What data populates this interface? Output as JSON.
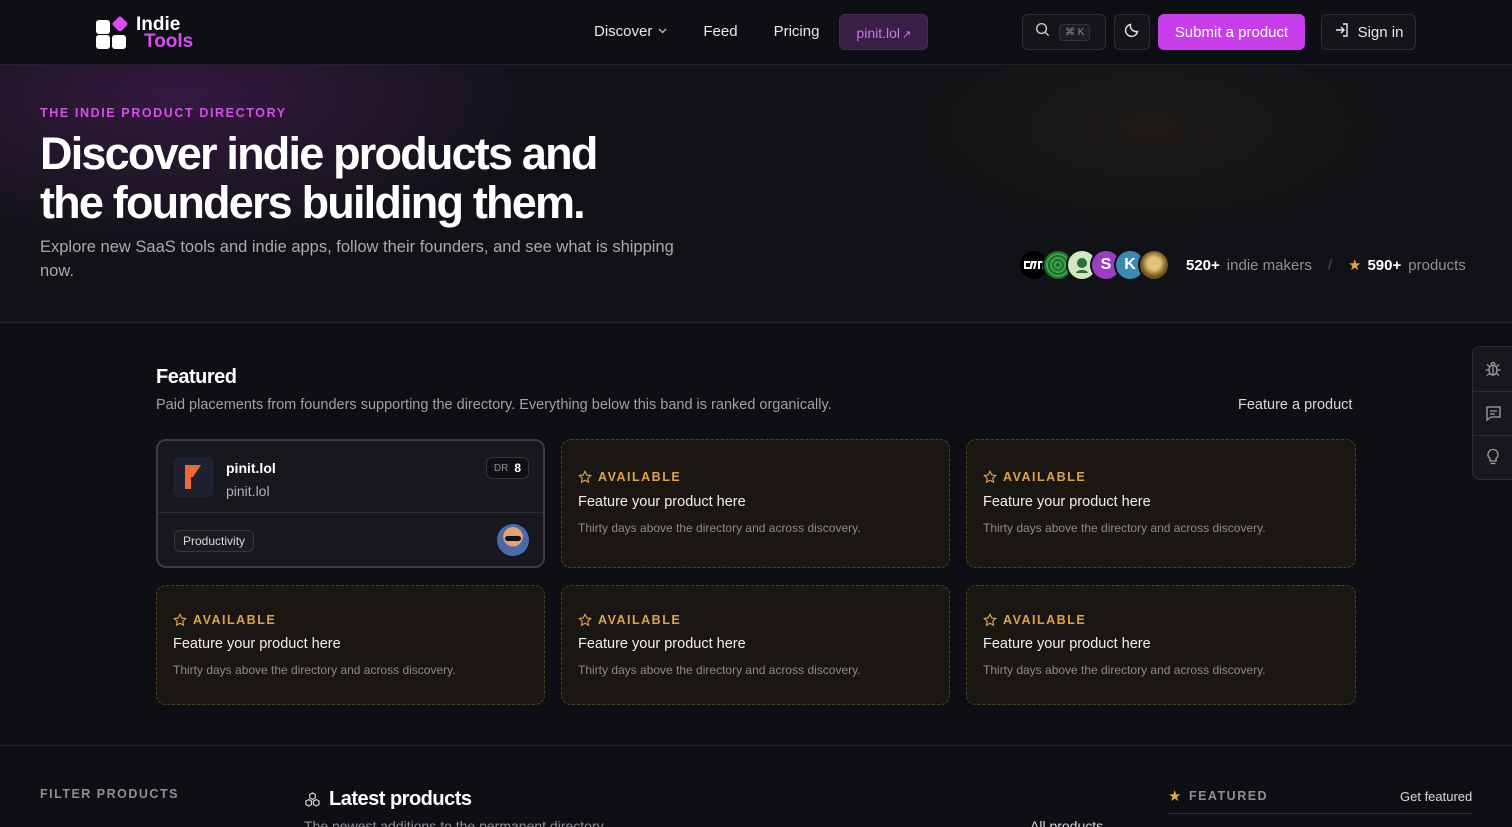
{
  "brand": {
    "line1": "Indie",
    "line2": "Tools",
    "accent": "#d94df0"
  },
  "nav": {
    "discover": "Discover",
    "feed": "Feed",
    "pricing": "Pricing",
    "pinit": "pinit.lol",
    "search_shortcut": "⌘ K",
    "submit": "Submit a product",
    "signin": "Sign in"
  },
  "hero": {
    "eyebrow": "THE INDIE PRODUCT DIRECTORY",
    "title": "Discover indie products and the founders building them.",
    "subtitle": "Explore new SaaS tools and indie apps, follow their founders, and see what is shipping now.",
    "avatars": [
      {
        "letter": "",
        "color": "#000000"
      },
      {
        "letter": "",
        "color": "#2f8a3a"
      },
      {
        "letter": "",
        "color": "#cfe7c2"
      },
      {
        "letter": "S",
        "color": "#9b3fc0"
      },
      {
        "letter": "K",
        "color": "#3b88b0"
      },
      {
        "letter": "",
        "color": "#a07a2c"
      }
    ],
    "makers_count": "520+",
    "makers_label": "indie makers",
    "separator": "/",
    "products_count": "590+",
    "products_label": "products"
  },
  "featured": {
    "title": "Featured",
    "subtitle": "Paid placements from founders supporting the directory. Everything below this band is ranked organically.",
    "link": "Feature a product",
    "product": {
      "name": "pinit.lol",
      "url": "pinit.lol",
      "dr_label": "DR",
      "dr_value": "8",
      "tag": "Productivity"
    },
    "slots": [
      {
        "badge": "AVAILABLE",
        "title": "Feature your product here",
        "desc": "Thirty days above the directory and across discovery."
      },
      {
        "badge": "AVAILABLE",
        "title": "Feature your product here",
        "desc": "Thirty days above the directory and across discovery."
      },
      {
        "badge": "AVAILABLE",
        "title": "Feature your product here",
        "desc": "Thirty days above the directory and across discovery."
      },
      {
        "badge": "AVAILABLE",
        "title": "Feature your product here",
        "desc": "Thirty days above the directory and across discovery."
      },
      {
        "badge": "AVAILABLE",
        "title": "Feature your product here",
        "desc": "Thirty days above the directory and across discovery."
      }
    ]
  },
  "side_tools": [
    "bug-icon",
    "message-icon",
    "lightbulb-icon"
  ],
  "bottom": {
    "filter_label": "FILTER PRODUCTS",
    "latest_title": "Latest products",
    "latest_sub": "The newest additions to the permanent directory",
    "all_products": "All products",
    "featured_label": "FEATURED",
    "get_featured": "Get featured"
  }
}
